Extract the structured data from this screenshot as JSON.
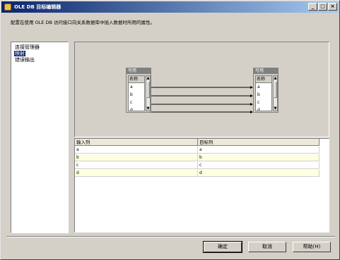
{
  "window": {
    "title": "OLE DB 目标编辑器",
    "minimize": "_",
    "maximize": "□",
    "close": "×"
  },
  "description": "配置在使用 OLE DB 访问接口向关系数据库中插入数据时所用的属性。",
  "nav": {
    "items": [
      {
        "label": "连接管理器"
      },
      {
        "label": "映射"
      },
      {
        "label": "错误输出"
      }
    ]
  },
  "mapping": {
    "source": {
      "title": "可用",
      "column_header": "名称",
      "rows": [
        "a",
        "b",
        "c",
        "d"
      ]
    },
    "destination": {
      "title": "可用",
      "column_header": "名称",
      "rows": [
        "a",
        "b",
        "c",
        "d"
      ]
    }
  },
  "grid": {
    "headers": [
      "输入列",
      "目标列"
    ],
    "rows": [
      [
        "a",
        "a"
      ],
      [
        "b",
        "b"
      ],
      [
        "c",
        "c"
      ],
      [
        "d",
        "d"
      ]
    ]
  },
  "buttons": {
    "ok": "确定",
    "cancel": "取消",
    "help": "帮助(H)"
  },
  "colors": {
    "titlebar_start": "#0a246a",
    "titlebar_end": "#a6caf0",
    "selected_nav": "#0a246a",
    "row_alt": "#ffffe1"
  }
}
